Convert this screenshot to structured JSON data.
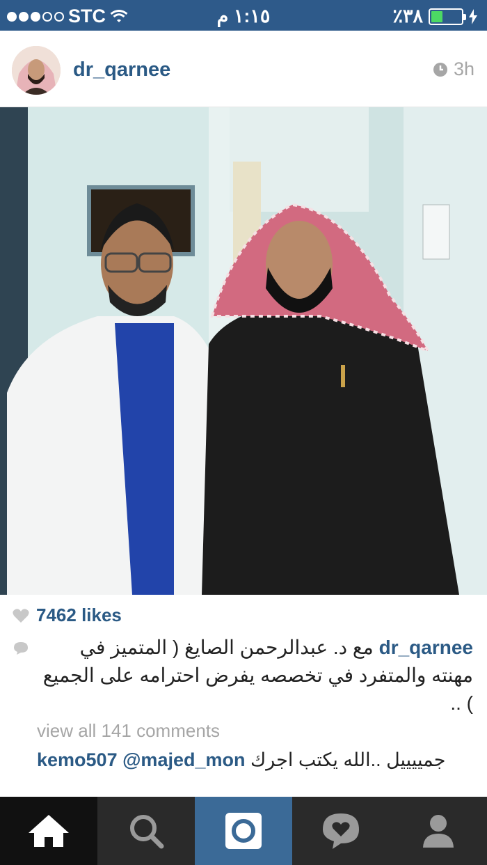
{
  "status_bar": {
    "carrier": "STC",
    "time": "١:١٥ م",
    "battery": "٪٣٨",
    "battery_level": 0.38
  },
  "post": {
    "username": "dr_qarnee",
    "time_ago": "3h",
    "likes": "7462 likes",
    "caption_user": "dr_qarnee",
    "caption_text": "مع د. عبدالرحمن الصايغ ( المتميز في مهنته والمتفرد في تخصصه يفرض احترامه على الجميع ) ..",
    "view_all": "view all 141 comments",
    "comment": {
      "user": "kemo507",
      "mention": "@majed_mon",
      "text": "جمييييل ..الله يكتب اجرك"
    }
  },
  "tab_bar": {
    "items": [
      "home-icon",
      "search-icon",
      "camera-icon",
      "activity-icon",
      "profile-icon"
    ]
  },
  "colors": {
    "status_bar": "#2e5a8a",
    "link": "#2b5a85",
    "tab_bar": "#2a2a2a",
    "tab_camera": "#3b6a97",
    "battery": "#4cd964"
  }
}
